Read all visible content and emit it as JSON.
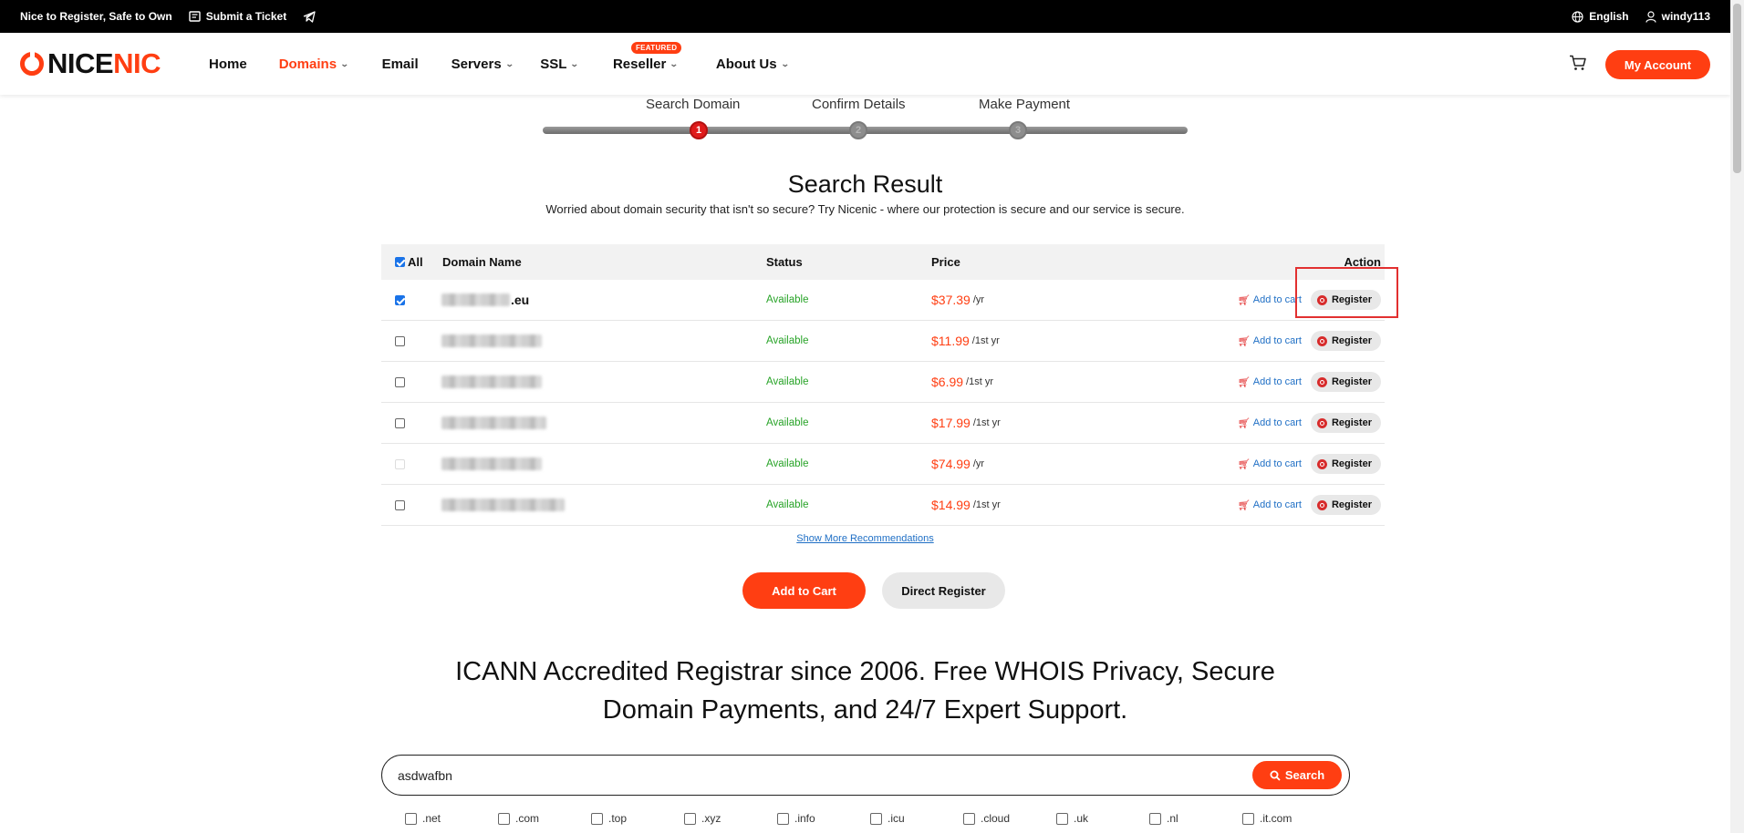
{
  "topbar": {
    "slogan": "Nice to Register, Safe to Own",
    "ticket": "Submit a Ticket",
    "language": "English",
    "username": "windy113"
  },
  "nav": {
    "logo_left": "NICE",
    "logo_right": "NIC",
    "items": [
      {
        "label": "Home"
      },
      {
        "label": "Domains"
      },
      {
        "label": "Email"
      },
      {
        "label": "Servers"
      },
      {
        "label": "SSL"
      },
      {
        "label": "Reseller",
        "badge": "FEATURED"
      },
      {
        "label": "About Us"
      }
    ],
    "account_button": "My Account"
  },
  "steps": [
    "Search Domain",
    "Confirm Details",
    "Make Payment"
  ],
  "step_numbers": [
    "1",
    "2",
    "3"
  ],
  "result": {
    "title": "Search Result",
    "subtitle": "Worried about domain security that isn't so secure? Try Nicenic - where our protection is secure and our service is secure."
  },
  "table": {
    "headers": {
      "all": "All",
      "domain": "Domain Name",
      "status": "Status",
      "price": "Price",
      "action": "Action"
    },
    "rows": [
      {
        "tail": ".eu",
        "status": "Available",
        "price": "$37.39",
        "per": "/yr",
        "checked": true
      },
      {
        "tail": "",
        "status": "Available",
        "price": "$11.99",
        "per": "/1st yr",
        "checked": false
      },
      {
        "tail": "",
        "status": "Available",
        "price": "$6.99",
        "per": "/1st yr",
        "checked": false
      },
      {
        "tail": "",
        "status": "Available",
        "price": "$17.99",
        "per": "/1st yr",
        "checked": false
      },
      {
        "tail": "",
        "status": "Available",
        "price": "$74.99",
        "per": "/yr",
        "checked": false
      },
      {
        "tail": "",
        "status": "Available",
        "price": "$14.99",
        "per": "/1st yr",
        "checked": false
      }
    ],
    "add_to_cart": "Add to cart",
    "register": "Register"
  },
  "show_more": "Show More Recommendations",
  "buttons": {
    "add_to_cart": "Add to Cart",
    "direct_register": "Direct Register"
  },
  "headline_line1": "ICANN Accredited Registrar since 2006. Free WHOIS Privacy, Secure",
  "headline_line2": "Domain Payments, and 24/7 Expert Support.",
  "search": {
    "value": "asdwafbn",
    "button": "Search"
  },
  "tlds": [
    ".net",
    ".com",
    ".top",
    ".xyz",
    ".info",
    ".icu",
    ".cloud",
    ".uk",
    ".nl",
    ".it.com"
  ],
  "colors": {
    "brand": "#ff3e12",
    "link": "#1f6fc5",
    "available": "#27a327"
  }
}
